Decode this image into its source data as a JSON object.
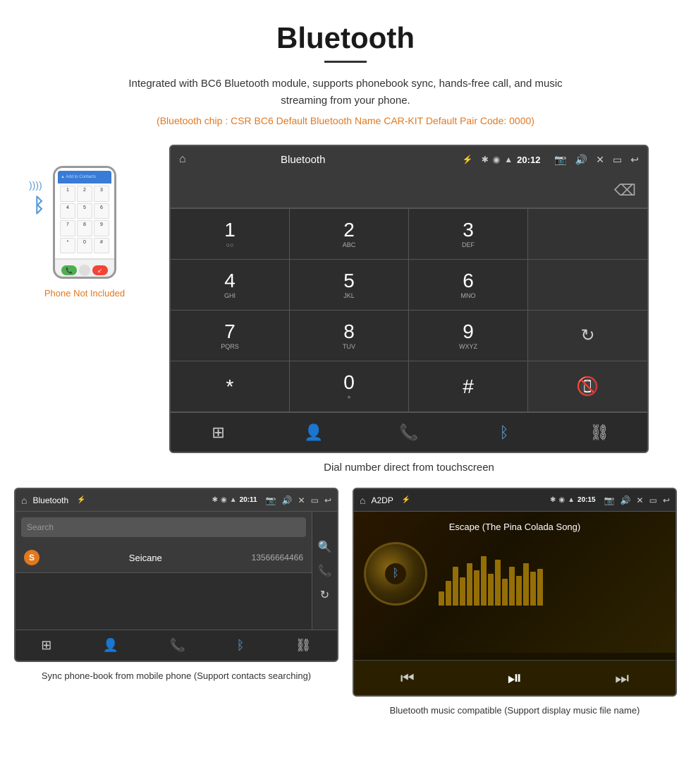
{
  "page": {
    "title": "Bluetooth",
    "description": "Integrated with BC6 Bluetooth module, supports phonebook sync, hands-free call, and music streaming from your phone.",
    "specs": "(Bluetooth chip : CSR BC6    Default Bluetooth Name CAR-KIT    Default Pair Code: 0000)",
    "dial_caption": "Dial number direct from touchscreen",
    "phonebook_caption": "Sync phone-book from mobile phone\n(Support contacts searching)",
    "music_caption": "Bluetooth music compatible\n(Support display music file name)",
    "phone_not_included": "Phone Not Included"
  },
  "topbar": {
    "home_icon": "⌂",
    "title_dial": "Bluetooth",
    "time_dial": "20:12",
    "title_pb": "Bluetooth",
    "time_pb": "20:11",
    "title_music": "A2DP",
    "time_music": "20:15",
    "usb_icon": "⚡",
    "bt_icon": "✱",
    "loc_icon": "◉",
    "signal_icon": "▲"
  },
  "dialpad": {
    "keys": [
      {
        "main": "1",
        "sub": ""
      },
      {
        "main": "2",
        "sub": "ABC"
      },
      {
        "main": "3",
        "sub": "DEF"
      },
      {
        "main": "",
        "sub": ""
      },
      {
        "main": "4",
        "sub": "GHI"
      },
      {
        "main": "5",
        "sub": "JKL"
      },
      {
        "main": "6",
        "sub": "MNO"
      },
      {
        "main": "",
        "sub": ""
      },
      {
        "main": "7",
        "sub": "PQRS"
      },
      {
        "main": "8",
        "sub": "TUV"
      },
      {
        "main": "9",
        "sub": "WXYZ"
      },
      {
        "main": "",
        "sub": ""
      },
      {
        "main": "*",
        "sub": ""
      },
      {
        "main": "0",
        "sub": "+"
      },
      {
        "main": "#",
        "sub": ""
      },
      {
        "main": "",
        "sub": ""
      }
    ]
  },
  "navbar": {
    "grid_icon": "⊞",
    "person_icon": "👤",
    "phone_icon": "📞",
    "bt_icon": "✱",
    "link_icon": "⛓"
  },
  "phonebook": {
    "search_placeholder": "Search",
    "contact_name": "Seicane",
    "contact_number": "13566664466",
    "contact_letter": "S"
  },
  "music": {
    "song_title": "Escape (The Pina Colada Song)",
    "eq_bars": [
      20,
      35,
      55,
      40,
      60,
      50,
      70,
      45,
      65,
      38,
      55,
      42,
      60,
      48,
      52
    ]
  },
  "colors": {
    "orange": "#e07820",
    "android_bg": "#2d2d2d",
    "android_bar": "#3a3a3a",
    "call_green": "#4caf50",
    "call_red": "#f44336",
    "music_bg": "#1a1200"
  }
}
